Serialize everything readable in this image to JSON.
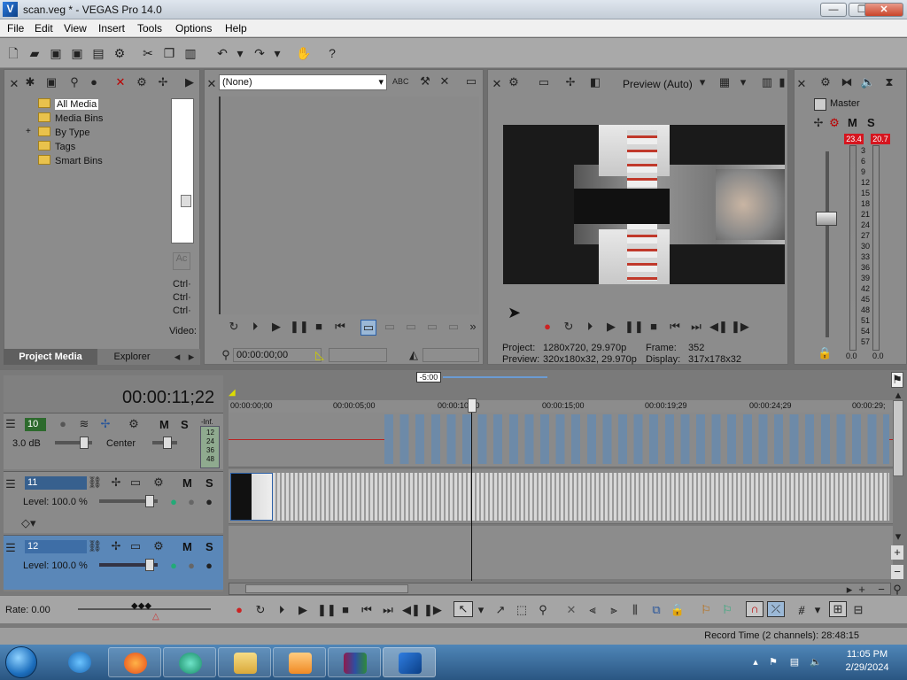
{
  "window": {
    "title": "scan.veg * - VEGAS Pro 14.0",
    "logo": "V"
  },
  "menu": [
    "File",
    "Edit",
    "View",
    "Insert",
    "Tools",
    "Options",
    "Help"
  ],
  "explorer": {
    "tree": [
      "All Media",
      "Media Bins",
      "By Type",
      "Tags",
      "Smart Bins"
    ],
    "expand_symbol": "+",
    "side_labels": [
      "Ctrl·",
      "Ctrl·",
      "Ctrl·",
      "Video:"
    ],
    "tabs": {
      "project_media": "Project Media",
      "explorer": "Explorer"
    }
  },
  "trimmer": {
    "selected": "(None)",
    "timecode": "00:00:00;00"
  },
  "preview": {
    "quality": "Preview (Auto)",
    "project_label": "Project:",
    "project_value": "1280x720, 29.970p",
    "preview_label": "Preview:",
    "preview_value": "320x180x32, 29.970p",
    "frame_label": "Frame:",
    "frame_value": "352",
    "display_label": "Display:",
    "display_value": "317x178x32"
  },
  "mixer": {
    "title": "Master",
    "peak_left": "23.4",
    "peak_right": "20.7",
    "scale": [
      "3",
      "6",
      "9",
      "12",
      "15",
      "18",
      "21",
      "24",
      "27",
      "30",
      "33",
      "36",
      "39",
      "42",
      "45",
      "48",
      "51",
      "54",
      "57"
    ],
    "bottom_left": "0.0",
    "bottom_right": "0.0",
    "m": "M",
    "s": "S"
  },
  "timeline": {
    "cursor_time": "00:00:11;22",
    "zoom_label": "-5:00",
    "ruler": [
      "00:00:00;00",
      "00:00:05;00",
      "00:00:10;00",
      "00:00:15;00",
      "00:00:19;29",
      "00:00:24;29",
      "00:00:29;"
    ],
    "audio_track": {
      "number": "10",
      "volume": "3.0 dB",
      "pan": "Center",
      "meter": [
        "-Inf.",
        "12",
        "24",
        "36",
        "48"
      ]
    },
    "video_track_1": {
      "number": "11",
      "level": "Level: 100.0 %"
    },
    "video_track_2": {
      "number": "12",
      "level": "Level: 100.0 %"
    },
    "m": "M",
    "s": "S",
    "rate": "Rate: 0.00"
  },
  "status": {
    "record_time": "Record Time (2 channels): 28:48:15"
  },
  "taskbar": {
    "time": "11:05 PM",
    "date": "2/29/2024"
  },
  "colors": {
    "peak_red": "#d6151f",
    "panel_bg": "#8c8c8c",
    "track_selected": "#5a87b8"
  }
}
